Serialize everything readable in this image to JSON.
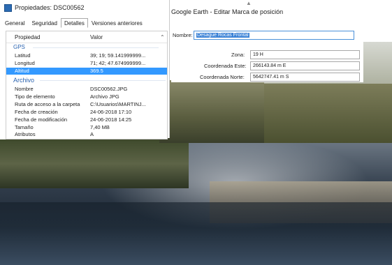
{
  "properties_window": {
    "title": "Propiedades: DSC00562",
    "tabs": [
      "General",
      "Seguridad",
      "Detalles",
      "Versiones anteriores"
    ],
    "active_tab": "Detalles",
    "columns": {
      "property": "Propiedad",
      "value": "Valor"
    },
    "groups": {
      "gps": "GPS",
      "file": "Archivo"
    },
    "gps_rows": [
      {
        "key": "Latitud",
        "value": "39; 19; 59.141999999..."
      },
      {
        "key": "Longitud",
        "value": "71; 42; 47.674999999..."
      },
      {
        "key": "Altitud",
        "value": "369.5"
      }
    ],
    "file_rows": [
      {
        "key": "Nombre",
        "value": "DSC00562.JPG"
      },
      {
        "key": "Tipo de elemento",
        "value": "Archivo JPG"
      },
      {
        "key": "Ruta de acceso a la carpeta",
        "value": "C:\\Usuarios\\MARTINJ..."
      },
      {
        "key": "Fecha de creación",
        "value": "24-06-2018 17:10"
      },
      {
        "key": "Fecha de modificación",
        "value": "24-06-2018 14:25"
      },
      {
        "key": "Tamaño",
        "value": "7,40 MB"
      },
      {
        "key": "Atributos",
        "value": "A"
      }
    ]
  },
  "google_earth_dialog": {
    "title": "Google Earth - Editar Marca de posición",
    "name_label": "Nombre:",
    "name_value": "Desague Rocas Frontal",
    "zone_label": "Zona:",
    "zone_value": "19 H",
    "easting_label": "Coordenada Este:",
    "easting_value": "266143.84 m E",
    "northing_label": "Coordenada Norte:",
    "northing_value": "5642747.41 m S"
  }
}
